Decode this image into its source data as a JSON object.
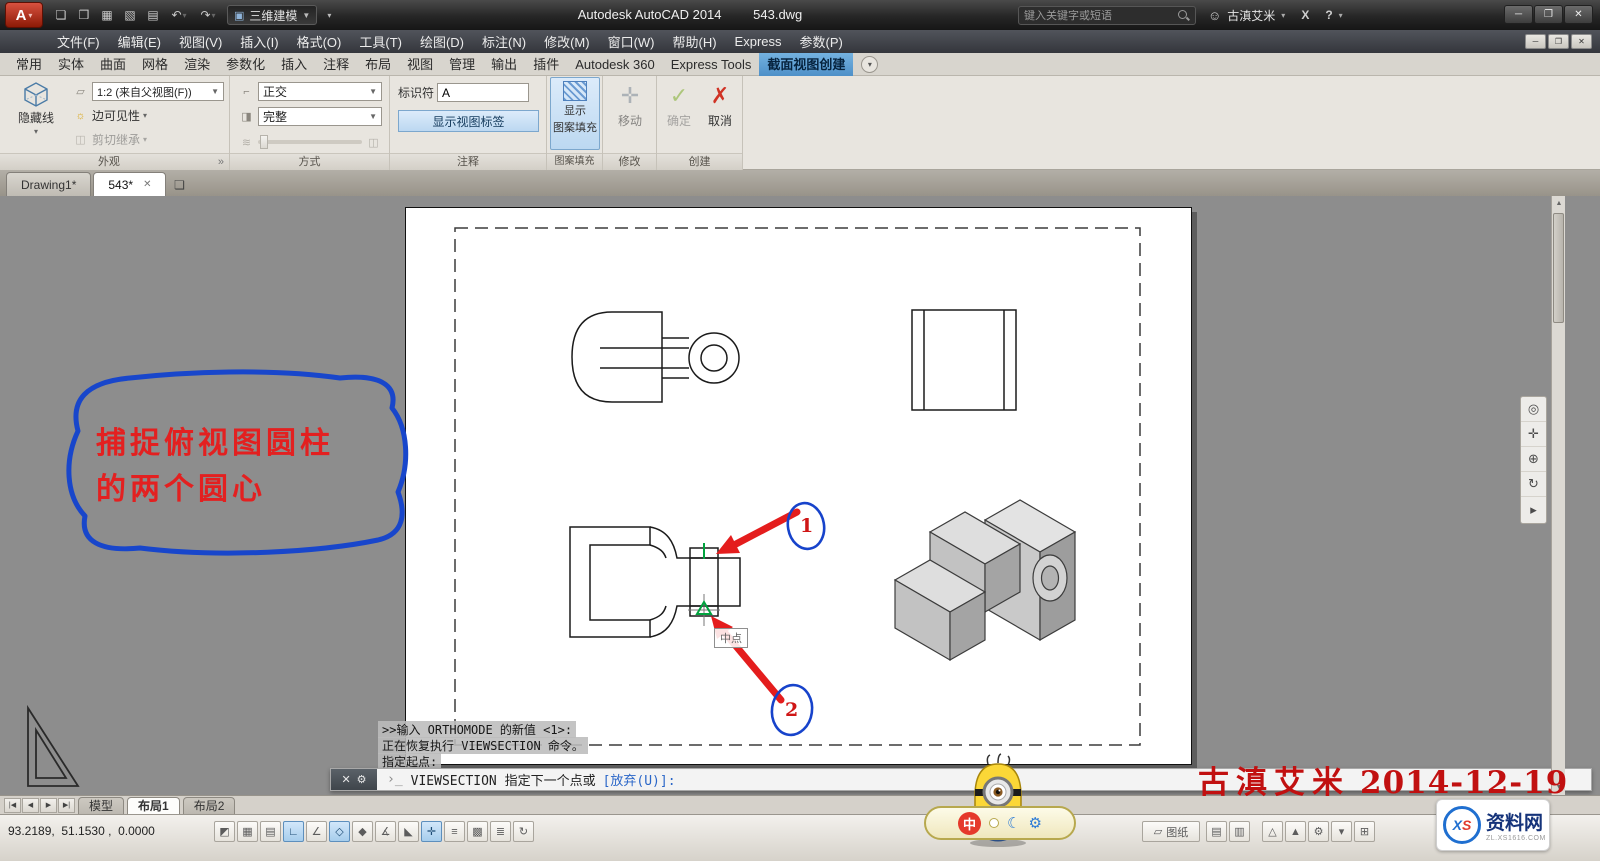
{
  "title_bar": {
    "app_title": "Autodesk AutoCAD 2014",
    "doc_title": "543.dwg",
    "workspace": "三维建模",
    "search_placeholder": "键入关键字或短语",
    "user_name": "古滇艾米"
  },
  "menu": {
    "items": [
      "文件(F)",
      "编辑(E)",
      "视图(V)",
      "插入(I)",
      "格式(O)",
      "工具(T)",
      "绘图(D)",
      "标注(N)",
      "修改(M)",
      "窗口(W)",
      "帮助(H)",
      "Express",
      "参数(P)"
    ]
  },
  "ribbon": {
    "tabs": [
      {
        "label": "常用",
        "active": false
      },
      {
        "label": "实体",
        "active": false
      },
      {
        "label": "曲面",
        "active": false
      },
      {
        "label": "网格",
        "active": false
      },
      {
        "label": "渲染",
        "active": false
      },
      {
        "label": "参数化",
        "active": false
      },
      {
        "label": "插入",
        "active": false
      },
      {
        "label": "注释",
        "active": false
      },
      {
        "label": "布局",
        "active": false
      },
      {
        "label": "视图",
        "active": false
      },
      {
        "label": "管理",
        "active": false
      },
      {
        "label": "输出",
        "active": false
      },
      {
        "label": "插件",
        "active": false
      },
      {
        "label": "Autodesk 360",
        "active": false
      },
      {
        "label": "Express Tools",
        "active": false
      },
      {
        "label": "截面视图创建",
        "active": true
      }
    ],
    "panels": {
      "appearance": {
        "title": "外观",
        "hidden_lines": "隐藏线",
        "scale_value": "1:2 (来自父视图(F))",
        "edge_visibility": "边可见性",
        "cut_inheritance": "剪切继承"
      },
      "method": {
        "title": "方式",
        "projection": "正交",
        "depth": "完整"
      },
      "annotation": {
        "title": "注释",
        "identifier_label": "标识符",
        "identifier_value": "A",
        "show_view_label": "显示视图标签"
      },
      "hatch": {
        "title": "图案填充",
        "line1": "显示",
        "line2": "图案填充"
      },
      "modify": {
        "title": "修改",
        "move": "移动"
      },
      "create": {
        "title": "创建",
        "ok": "确定",
        "cancel": "取消"
      }
    }
  },
  "file_tabs": {
    "tab1": "Drawing1*",
    "tab2": "543*"
  },
  "canvas": {
    "note_line1": "捕捉俯视图圆柱",
    "note_line2": "的两个圆心",
    "marker1": "1",
    "marker2": "2",
    "snap_tooltip": "中点"
  },
  "command": {
    "history1": ">>输入 ORTHOMODE 的新值 <1>:",
    "history2": "正在恢复执行 VIEWSECTION 命令。",
    "history3": "指定起点:",
    "prompt": "VIEWSECTION 指定下一个点或",
    "prompt_option": "[放弃(U)]:"
  },
  "layout_tabs": {
    "model": "模型",
    "layout1": "布局1",
    "layout2": "布局2"
  },
  "status": {
    "coordinates": "93.2189,  51.1530 ,  0.0000",
    "paper_space": "图纸"
  },
  "status_icons": [
    "◩",
    "▦",
    "▤",
    "∟",
    "∠",
    "◇",
    "◆",
    "∡",
    "◣",
    "✛",
    "≡",
    "▩",
    "≣",
    "↻"
  ],
  "status_right_icons": [
    "▤",
    "▥",
    "△",
    "▲",
    "⚙",
    "▾",
    "⊞"
  ],
  "ime": {
    "label": "中"
  },
  "watermark": {
    "signature": "古滇艾米",
    "date": "2014-12-19"
  },
  "logo": {
    "x": "X",
    "s": "S",
    "site": "资料网",
    "url": "ZL.XS1616.COM"
  },
  "icons": {
    "app_logo": "A",
    "caret": "▾",
    "combo": "▼",
    "new": "❏",
    "open": "❒",
    "save": "▦",
    "save_as": "▧",
    "plot": "▤",
    "undo": "↶",
    "redo": "↷",
    "workspace_cube": "▣",
    "min": "─",
    "max": "❐",
    "close": "✕",
    "user": "☺",
    "exchange": "X",
    "help": "?",
    "lightbulb": "☼",
    "scale": "▱",
    "cut": "◫",
    "m1": "⌐",
    "m2": "◨",
    "m3": "≋",
    "expand": "»",
    "check": "✓",
    "cross": "✗",
    "move": "✛",
    "new_tab": "❏",
    "gear": "⚙",
    "type_prompt": "›_",
    "moon": "☾",
    "nav_wheel": "◎",
    "nav_pan": "✛",
    "nav_zoom": "⊕",
    "nav_orbit": "↻",
    "nav_motion": "▸",
    "up": "▲",
    "down": "▼",
    "tab_first": "|◀",
    "tab_prev": "◀",
    "tab_next": "▶",
    "tab_last": "▶|",
    "paper": "▱"
  }
}
